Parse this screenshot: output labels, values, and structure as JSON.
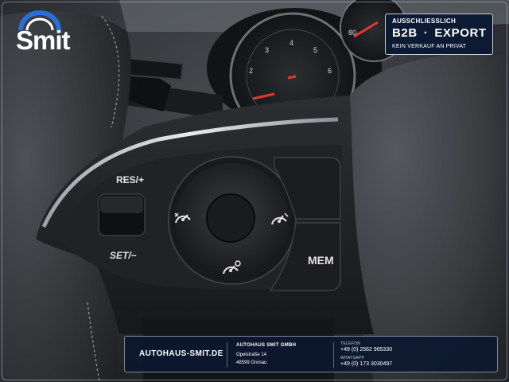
{
  "logo": {
    "text": "Smit"
  },
  "badge": {
    "top": "AUSSCHLIESSLICH",
    "main_left": "B2B",
    "main_right": "EXPORT",
    "sub": "KEIN VERKAUF AN PRIVAT"
  },
  "controls": {
    "res_label": "RES/+",
    "set_label": "SET/−",
    "mem_label": "MEM"
  },
  "footer": {
    "url": "AUTOHAUS-SMIT.DE",
    "company": "AUTOHAUS SMIT GMBH",
    "street": "Opelstraße 14",
    "city": "48599 Gronau",
    "phone_label": "TELEFON",
    "phone": "+49 (0) 2562 965330",
    "whatsapp_label": "WHATSAPP",
    "whatsapp": "+49 (0) 173 3030497"
  },
  "colors": {
    "brand_navy": "#0d1a33",
    "logo_blue": "#2a6ed6",
    "gauge_red": "#e23a2c"
  }
}
